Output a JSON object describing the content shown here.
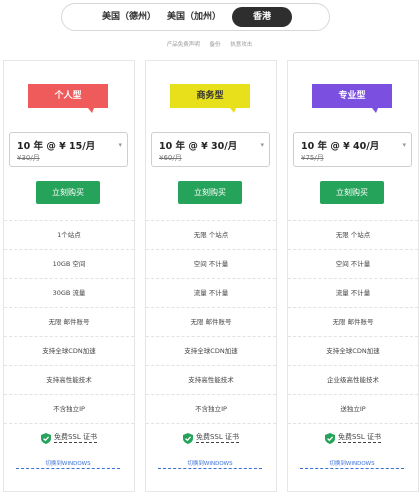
{
  "region_tabs": [
    "美国（德州）",
    "美国（加州）",
    "香港"
  ],
  "sub_links": [
    "产品免费声明",
    "备份",
    "执意攻击"
  ],
  "plans": [
    {
      "tag": "个人型",
      "tag_color": "#ef5a5a",
      "price": "10 年 @ ¥ 15/月",
      "old_price": "¥30/月",
      "buy": "立刻购买",
      "features": [
        "1个站点",
        "10GB 空间",
        "30GB 流量",
        "无限 邮件账号",
        "支持全球CDN加速",
        "支持高性能技术",
        "不含独立IP"
      ],
      "ssl": "免费SSL 证书",
      "win": "切换到WINDOWS"
    },
    {
      "tag": "商务型",
      "tag_color": "#e8e01a",
      "price": "10 年 @ ¥ 30/月",
      "old_price": "¥60/月",
      "buy": "立刻购买",
      "features": [
        "无限 个站点",
        "空间 不计量",
        "流量 不计量",
        "无限 邮件账号",
        "支持全球CDN加速",
        "支持高性能技术",
        "不含独立IP"
      ],
      "ssl": "免费SSL 证书",
      "win": "切换到WINDOWS"
    },
    {
      "tag": "专业型",
      "tag_color": "#7b4fe0",
      "price": "10 年 @ ¥ 40/月",
      "old_price": "¥75/月",
      "buy": "立刻购买",
      "features": [
        "无限 个站点",
        "空间 不计量",
        "流量 不计量",
        "无限 邮件账号",
        "支持全球CDN加速",
        "企业级高性能技术",
        "送独立IP"
      ],
      "ssl": "免费SSL 证书",
      "win": "切换到WINDOWS"
    }
  ],
  "colors": {
    "buy_button": "#25a35a",
    "ssl_shield": "#25a35a",
    "link": "#3a6fd8",
    "active_tab": "#2e2e2e"
  }
}
